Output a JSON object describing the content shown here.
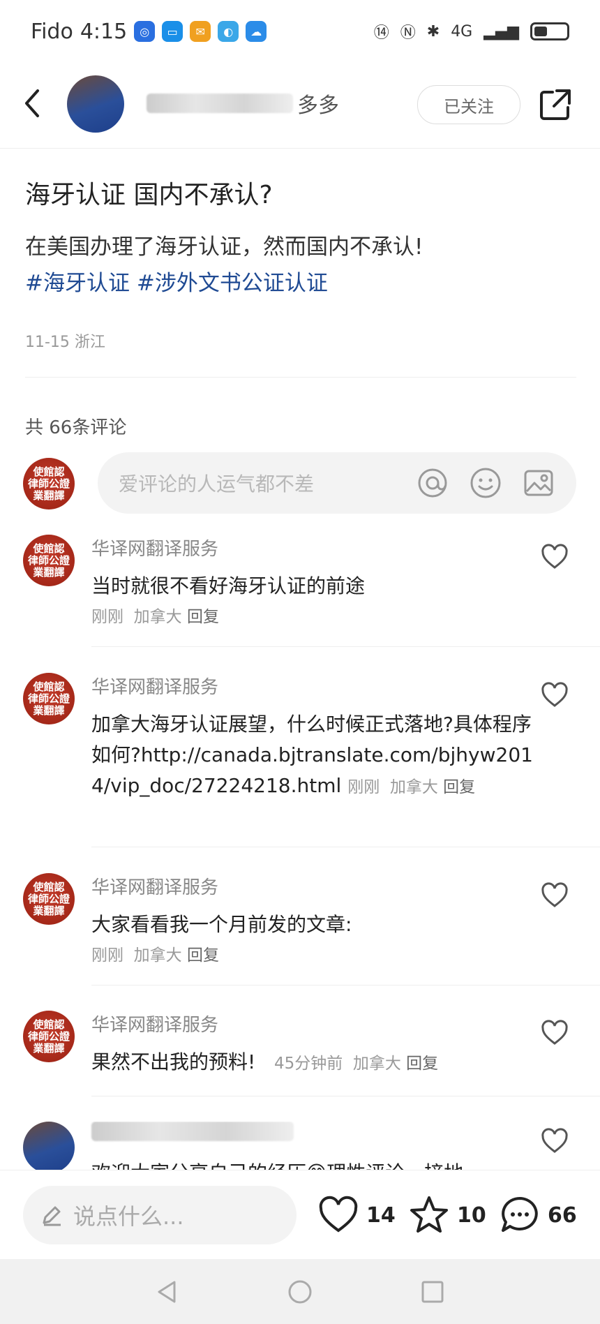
{
  "status_bar": {
    "carrier": "Fido",
    "time": "4:15",
    "network": "4G",
    "battery_percent": 40
  },
  "header": {
    "username_visible": "多多",
    "follow_label": "已关注"
  },
  "post": {
    "title": "海牙认证 国内不承认?",
    "body": "在美国办理了海牙认证，然而国内不承认!",
    "tags": [
      "#海牙认证",
      "#涉外文书公证认证"
    ],
    "date": "11-15",
    "location": "浙江"
  },
  "comments_section": {
    "count_label": "共 66条评论",
    "input_placeholder": "爱评论的人运气都不差",
    "avatar_text": [
      "使館認",
      "律師公證",
      "業翻譯"
    ]
  },
  "comments": [
    {
      "author": "华译网翻译服务",
      "text": "当时就很不看好海牙认证的前途",
      "time": "刚刚",
      "location": "加拿大",
      "reply": "回复"
    },
    {
      "author": "华译网翻译服务",
      "text": "加拿大海牙认证展望，什么时候正式落地?具体程序如何?http://canada.bjtranslate.com/bjhyw2014/vip_doc/27224218.html",
      "time": "刚刚",
      "location": "加拿大",
      "reply": "回复"
    },
    {
      "author": "华译网翻译服务",
      "text": "大家看看我一个月前发的文章:",
      "time": "刚刚",
      "location": "加拿大",
      "reply": "回复"
    },
    {
      "author": "华译网翻译服务",
      "text": "果然不出我的预料!",
      "time": "45分钟前",
      "location": "加拿大",
      "reply": "回复"
    },
    {
      "author": "",
      "text": "欢迎大家分享自己的经历😁理性评论，接地",
      "time": "",
      "location": "",
      "reply": ""
    }
  ],
  "bottom_bar": {
    "input_placeholder": "说点什么...",
    "likes": "14",
    "favorites": "10",
    "comments": "66"
  }
}
